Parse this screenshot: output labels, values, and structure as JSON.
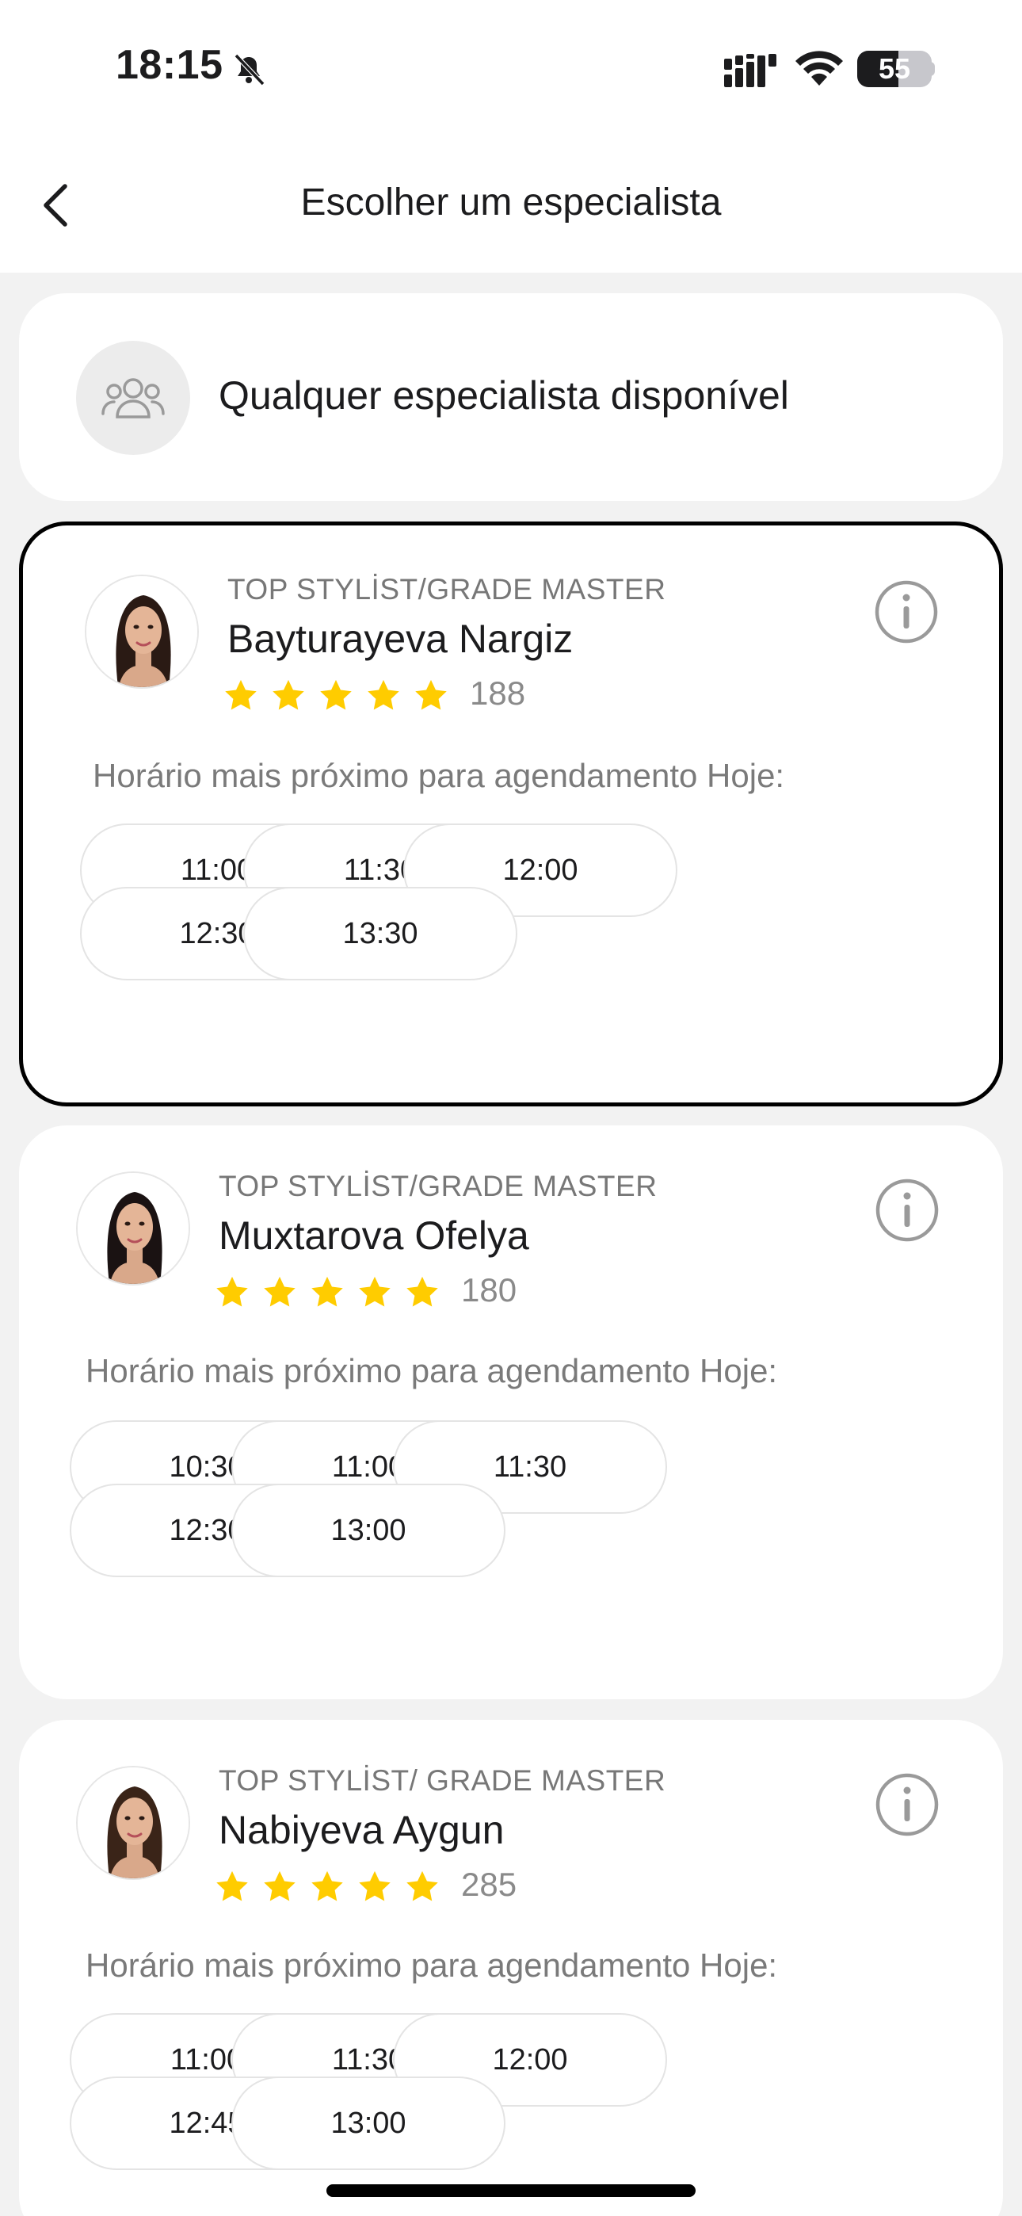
{
  "status_bar": {
    "time": "18:15",
    "battery": "55",
    "battery_level": 0.55
  },
  "header": {
    "title": "Escolher um especialista"
  },
  "any_specialist": {
    "label": "Qualquer especialista disponível"
  },
  "colors": {
    "star": "#FFCC00",
    "selected_border": "#000000"
  },
  "specialists": [
    {
      "grade": "TOP STYLİST/GRADE MASTER",
      "name": "Bayturayeva Nargiz",
      "rating": 5,
      "reviews": "188",
      "nearest_label": "Horário mais próximo para agendamento Hoje:",
      "slots": [
        "11:00",
        "11:30",
        "12:00",
        "12:30",
        "13:30"
      ],
      "selected": true
    },
    {
      "grade": "TOP STYLİST/GRADE MASTER",
      "name": "Muxtarova Ofelya",
      "rating": 5,
      "reviews": "180",
      "nearest_label": "Horário mais próximo para agendamento Hoje:",
      "slots": [
        "10:30",
        "11:00",
        "11:30",
        "12:30",
        "13:00"
      ],
      "selected": false
    },
    {
      "grade": "TOP STYLİST/ GRADE MASTER",
      "name": "Nabiyeva Aygun",
      "rating": 5,
      "reviews": "285",
      "nearest_label": "Horário mais próximo para agendamento Hoje:",
      "slots": [
        "11:00",
        "11:30",
        "12:00",
        "12:45",
        "13:00"
      ],
      "selected": false
    }
  ]
}
